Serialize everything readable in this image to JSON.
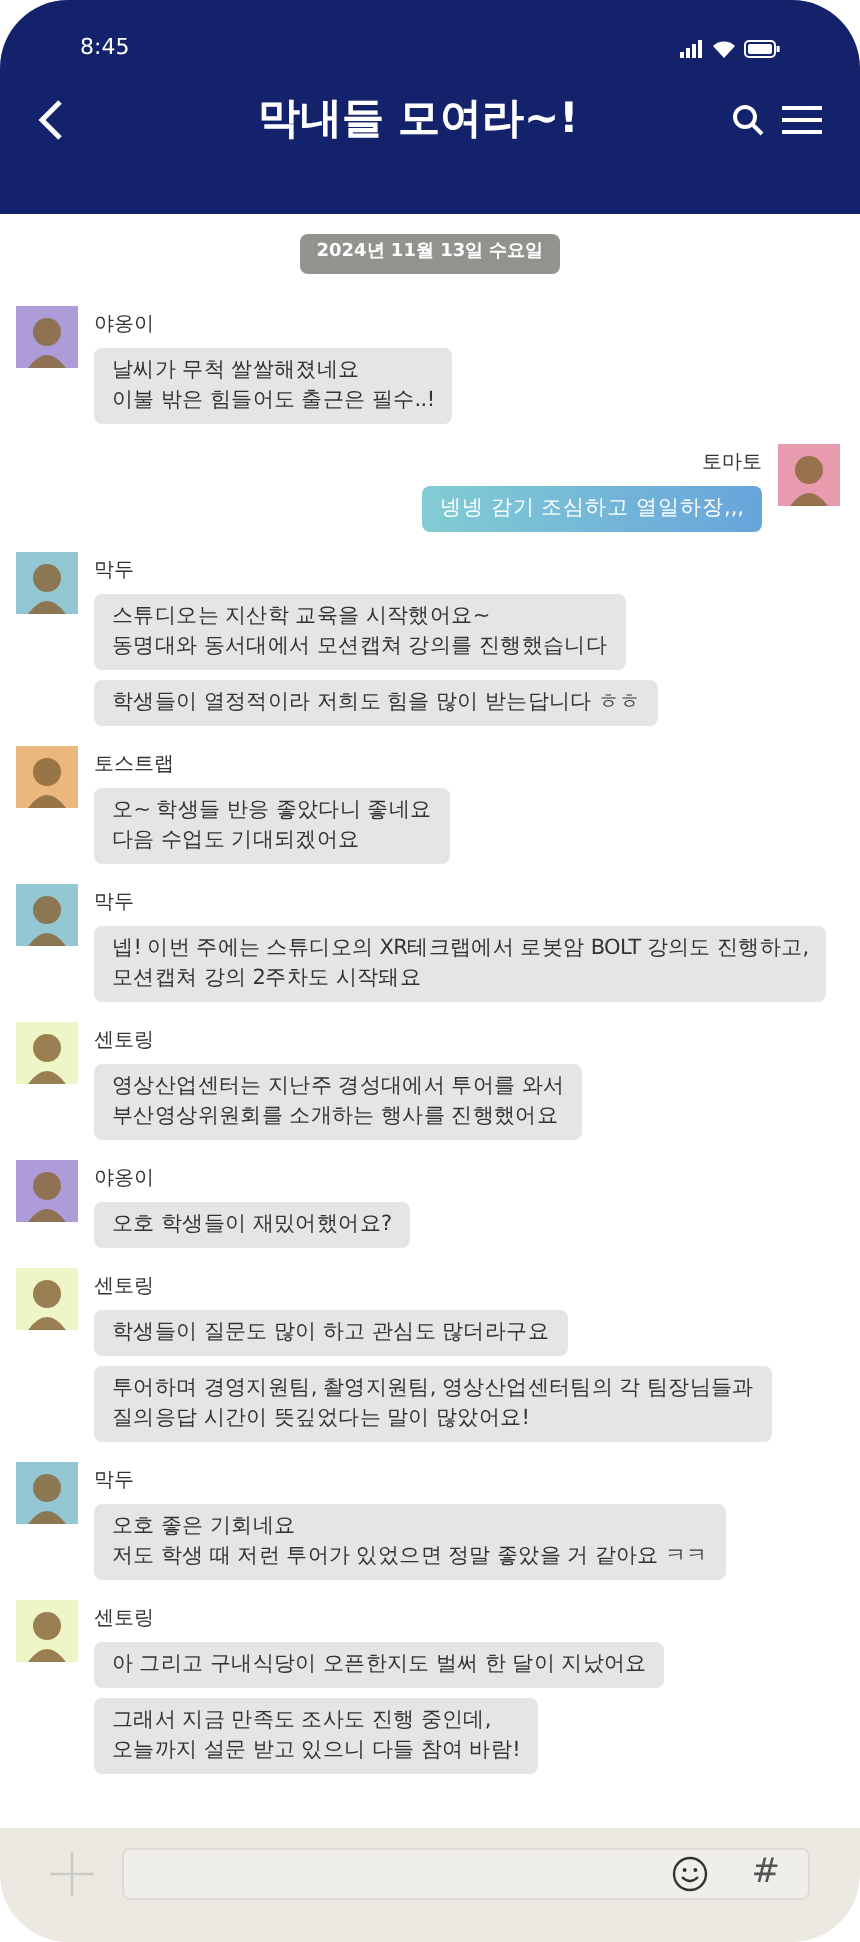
{
  "status_bar": {
    "time": "8:45"
  },
  "header": {
    "title": "막내들 모여라~!"
  },
  "date_divider": "2024년 11월 13일 수요일",
  "messages": [
    {
      "sender": "야옹이",
      "mine": false,
      "color": "#ae9cd9",
      "bubbles": [
        "날씨가 무척 쌀쌀해졌네요\n이불 밖은 힘들어도 출근은 필수..!"
      ]
    },
    {
      "sender": "토마토",
      "mine": true,
      "color": "#e89aae",
      "bubbles": [
        "넹넹 감기 조심하고 열일하장,,,"
      ]
    },
    {
      "sender": "막두",
      "mine": false,
      "color": "#93c7d3",
      "bubbles": [
        "스튜디오는 지산학 교육을 시작했어요~\n동명대와 동서대에서 모션캡쳐 강의를 진행했습니다",
        "학생들이 열정적이라 저희도 힘을 많이 받는답니다 ㅎㅎ"
      ]
    },
    {
      "sender": "토스트랩",
      "mine": false,
      "color": "#ecb77c",
      "bubbles": [
        "오~ 학생들 반응 좋았다니 좋네요\n다음 수업도 기대되겠어요"
      ]
    },
    {
      "sender": "막두",
      "mine": false,
      "color": "#93c7d3",
      "bubbles": [
        "넵! 이번 주에는 스튜디오의 XR테크랩에서 로봇암 BOLT 강의도 진행하고,\n모션캡쳐 강의 2주차도 시작돼요"
      ]
    },
    {
      "sender": "센토링",
      "mine": false,
      "color": "#eef5c6",
      "bubbles": [
        "영상산업센터는 지난주 경성대에서 투어를 와서\n부산영상위원회를 소개하는 행사를 진행했어요"
      ]
    },
    {
      "sender": "야옹이",
      "mine": false,
      "color": "#ae9cd9",
      "bubbles": [
        "오호 학생들이 재밌어했어요?"
      ]
    },
    {
      "sender": "센토링",
      "mine": false,
      "color": "#eef5c6",
      "bubbles": [
        "학생들이 질문도 많이 하고 관심도 많더라구요",
        "투어하며 경영지원팀, 촬영지원팀, 영상산업센터팀의 각 팀장님들과\n질의응답 시간이 뜻깊었다는 말이 많았어요!"
      ]
    },
    {
      "sender": "막두",
      "mine": false,
      "color": "#93c7d3",
      "bubbles": [
        "오호 좋은 기회네요\n저도 학생 때 저런 투어가 있었으면 정말 좋았을 거 같아요 ㅋㅋ"
      ]
    },
    {
      "sender": "센토링",
      "mine": false,
      "color": "#eef5c6",
      "bubbles": [
        "아 그리고 구내식당이 오픈한지도 벌써 한 달이 지났어요",
        "그래서 지금 만족도 조사도 진행 중인데,\n오늘까지 설문 받고 있으니 다들 참여 바람!"
      ]
    }
  ],
  "input_bar": {
    "hash_key": "#"
  }
}
